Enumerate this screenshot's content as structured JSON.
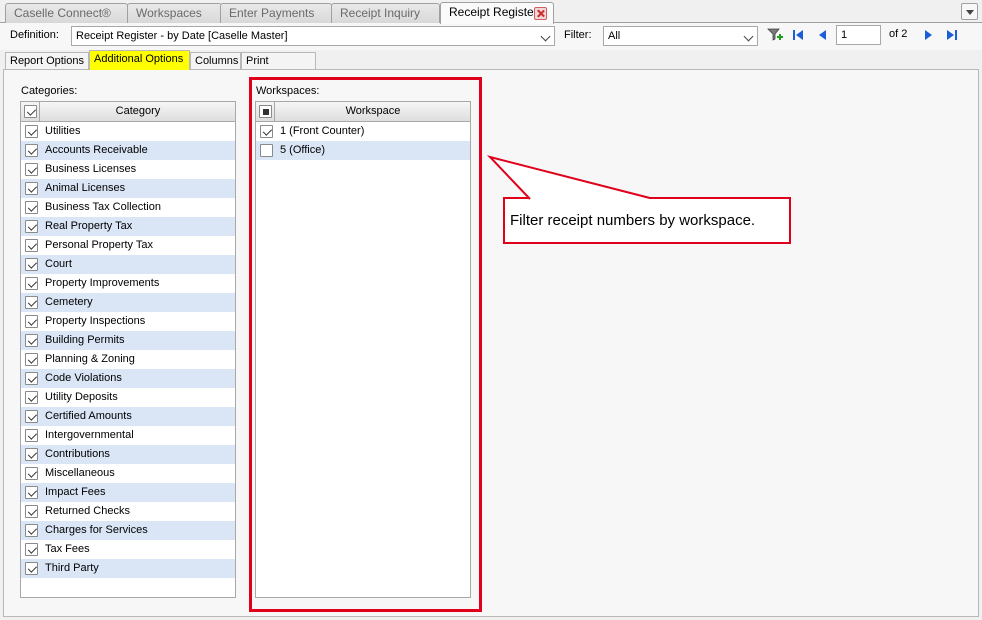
{
  "tabs": [
    {
      "label": "Caselle Connect®",
      "active": false
    },
    {
      "label": "Workspaces",
      "active": false
    },
    {
      "label": "Enter Payments",
      "active": false
    },
    {
      "label": "Receipt Inquiry",
      "active": false
    },
    {
      "label": "Receipt Register",
      "active": true
    }
  ],
  "toolbar": {
    "definition_label": "Definition:",
    "definition_value": "Receipt Register - by Date [Caselle Master]",
    "filter_label": "Filter:",
    "filter_value": "All",
    "page_value": "1",
    "page_total": "of 2"
  },
  "subtabs": [
    {
      "label": "Report Options",
      "active": false
    },
    {
      "label": "Additional Options",
      "active": true
    },
    {
      "label": "Columns",
      "active": false
    },
    {
      "label": "Print Settings",
      "active": false
    }
  ],
  "categories": {
    "title": "Categories:",
    "header": "Category",
    "items": [
      {
        "label": "Utilities",
        "checked": true
      },
      {
        "label": "Accounts Receivable",
        "checked": true
      },
      {
        "label": "Business Licenses",
        "checked": true
      },
      {
        "label": "Animal Licenses",
        "checked": true
      },
      {
        "label": "Business Tax Collection",
        "checked": true
      },
      {
        "label": "Real Property Tax",
        "checked": true
      },
      {
        "label": "Personal Property Tax",
        "checked": true
      },
      {
        "label": "Court",
        "checked": true
      },
      {
        "label": "Property Improvements",
        "checked": true
      },
      {
        "label": "Cemetery",
        "checked": true
      },
      {
        "label": "Property Inspections",
        "checked": true
      },
      {
        "label": "Building Permits",
        "checked": true
      },
      {
        "label": "Planning & Zoning",
        "checked": true
      },
      {
        "label": "Code Violations",
        "checked": true
      },
      {
        "label": "Utility Deposits",
        "checked": true
      },
      {
        "label": "Certified Amounts",
        "checked": true
      },
      {
        "label": "Intergovernmental",
        "checked": true
      },
      {
        "label": "Contributions",
        "checked": true
      },
      {
        "label": "Miscellaneous",
        "checked": true
      },
      {
        "label": "Impact Fees",
        "checked": true
      },
      {
        "label": "Returned Checks",
        "checked": true
      },
      {
        "label": "Charges for Services",
        "checked": true
      },
      {
        "label": "Tax Fees",
        "checked": true
      },
      {
        "label": "Third Party",
        "checked": true
      }
    ]
  },
  "workspaces": {
    "title": "Workspaces:",
    "header": "Workspace",
    "items": [
      {
        "label": "1 (Front Counter)",
        "checked": true
      },
      {
        "label": "5 (Office)",
        "checked": false
      }
    ]
  },
  "callout": {
    "text": "Filter receipt numbers by workspace."
  },
  "colors": {
    "highlight": "#e0001b",
    "row_alt": "#dae5f6",
    "active_subtab": "#ffff00"
  }
}
